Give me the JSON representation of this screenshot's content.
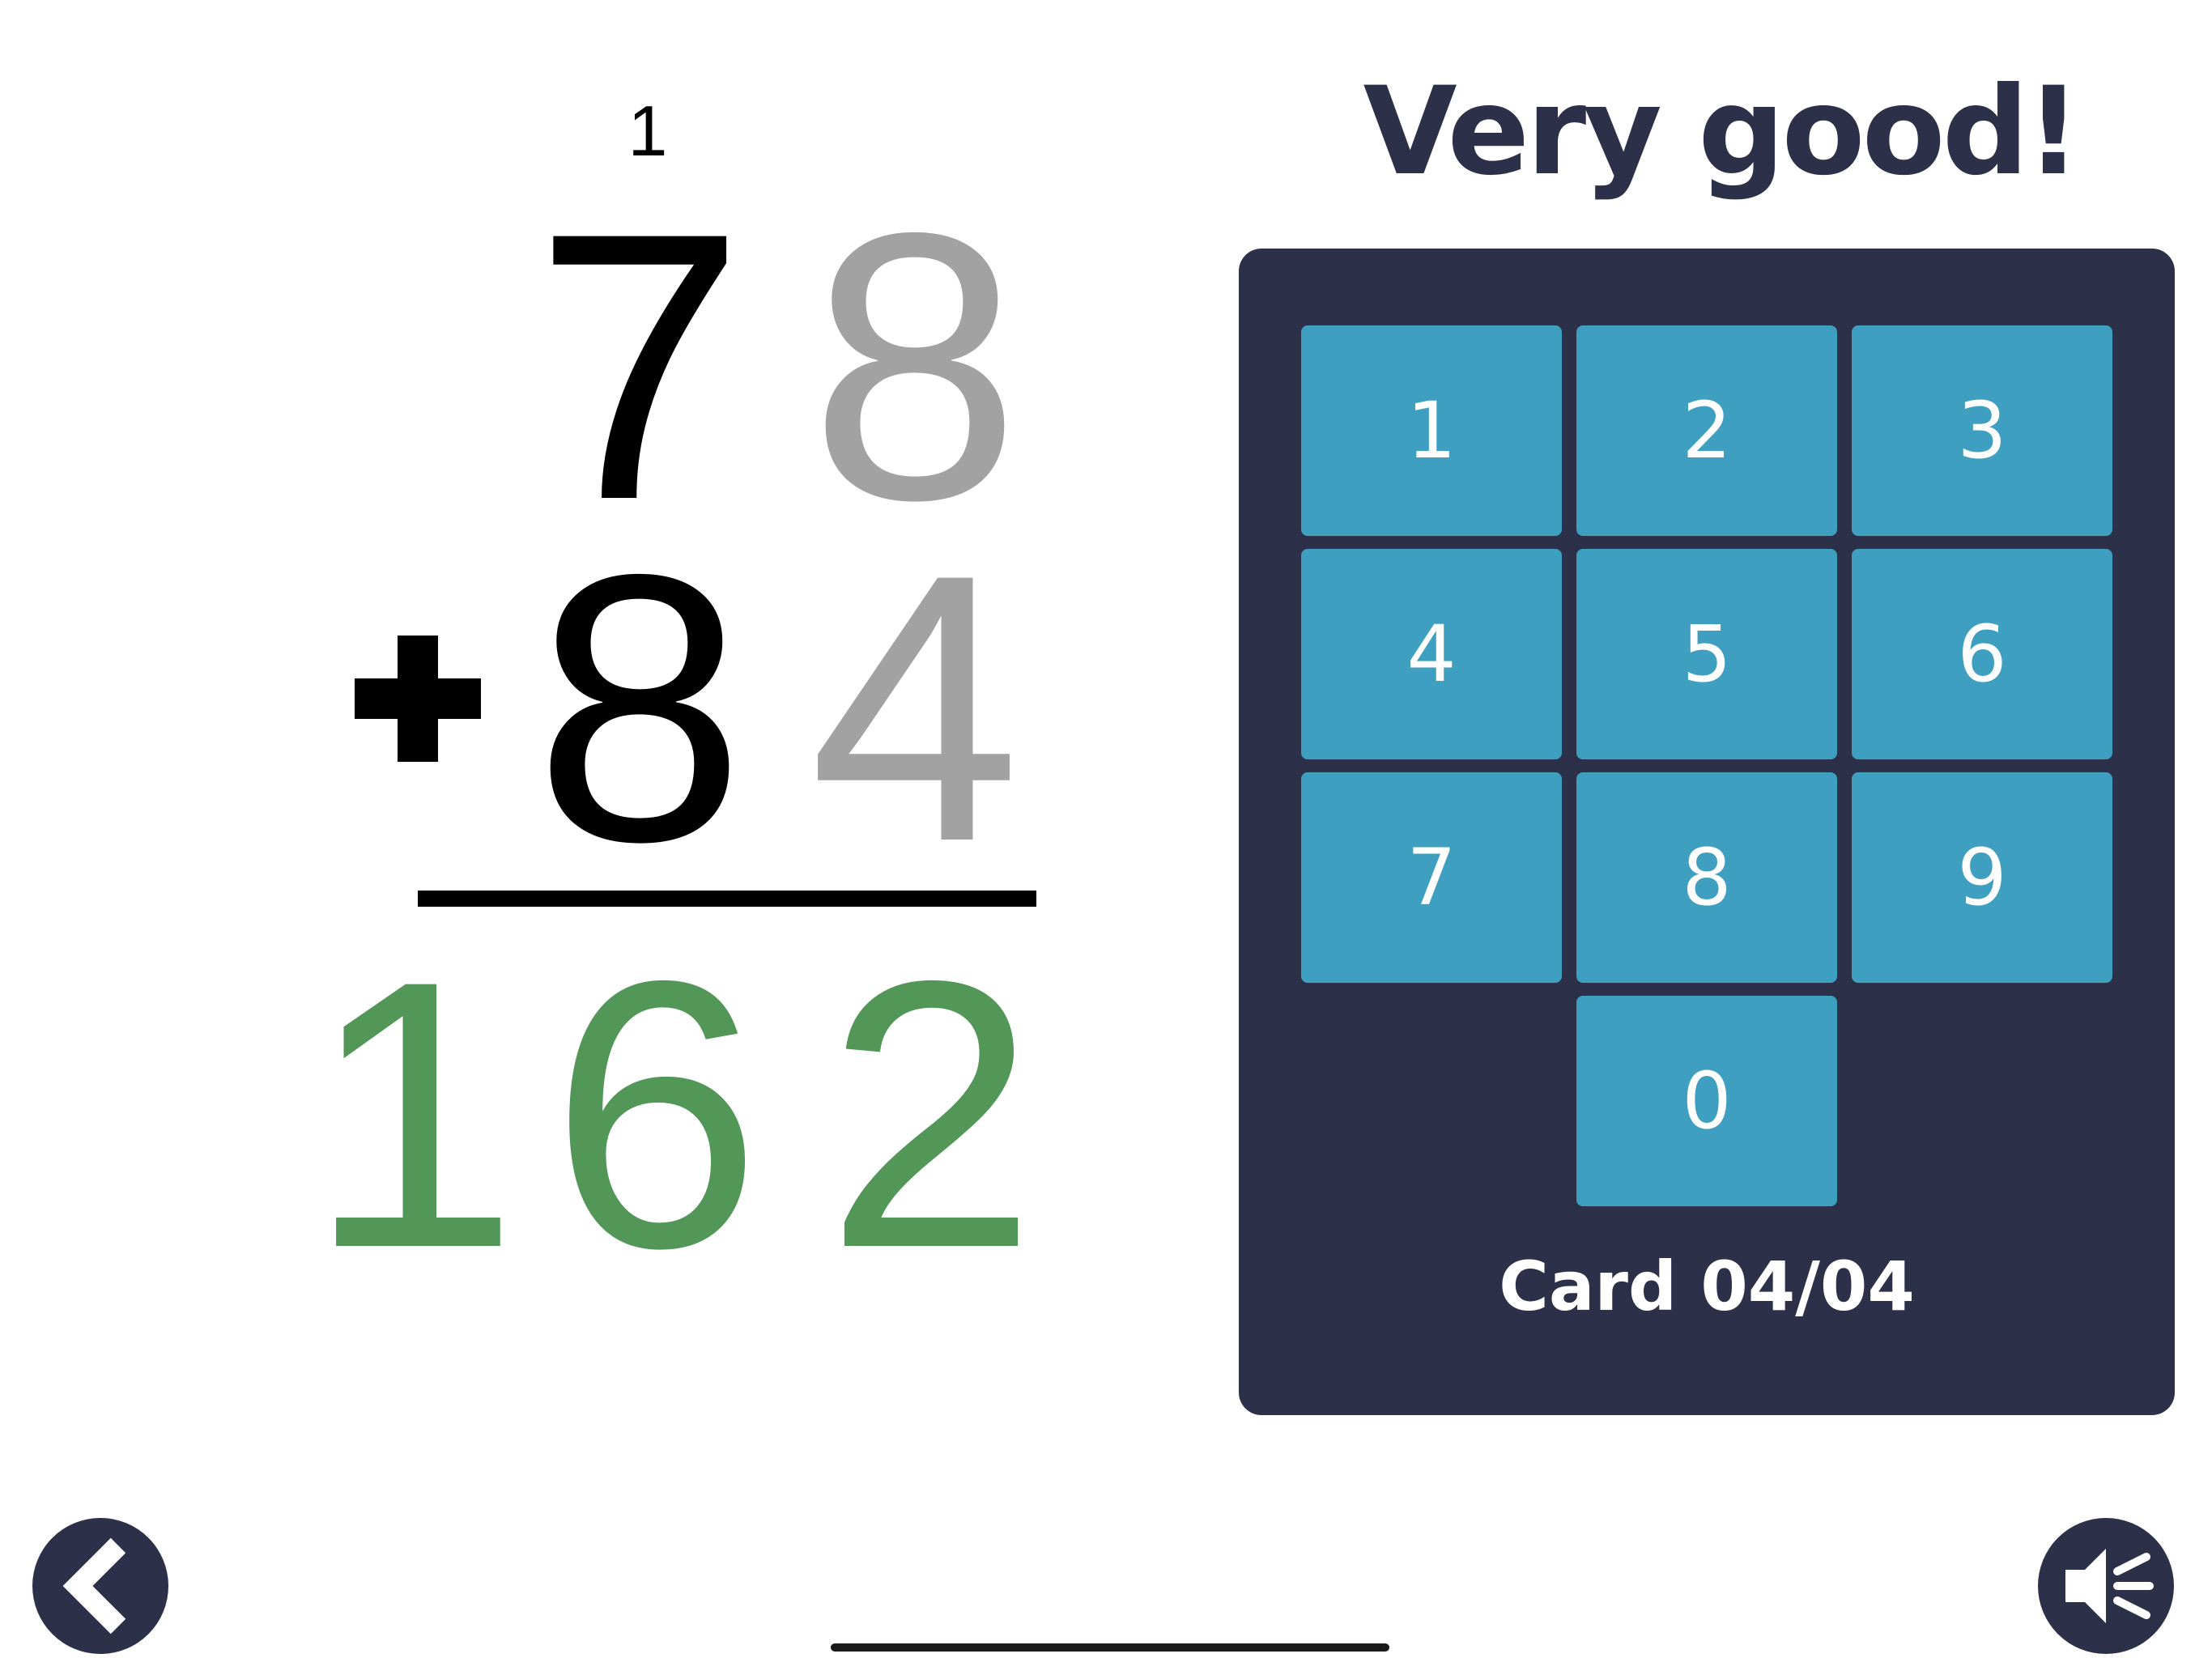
{
  "problem": {
    "carry": "1",
    "top": {
      "tens": "7",
      "ones": "8"
    },
    "bottom": {
      "tens": "8",
      "ones": "4"
    },
    "operator_icon": "plus-icon",
    "result": {
      "hundreds": "1",
      "tens": "6",
      "ones": "2"
    }
  },
  "feedback": {
    "message": "Very good!"
  },
  "keypad": {
    "keys": [
      "1",
      "2",
      "3",
      "4",
      "5",
      "6",
      "7",
      "8",
      "9",
      "0"
    ]
  },
  "progress": {
    "card_label": "Card 04/04"
  },
  "controls": {
    "back_icon": "chevron-left-icon",
    "sound_icon": "speaker-icon"
  },
  "colors": {
    "panel": "#2d3049",
    "key": "#3e9fc0",
    "done_digit": "#a2a2a2",
    "current_digit": "#000000",
    "result_digit": "#529758",
    "feedback_text": "#2d3049"
  }
}
